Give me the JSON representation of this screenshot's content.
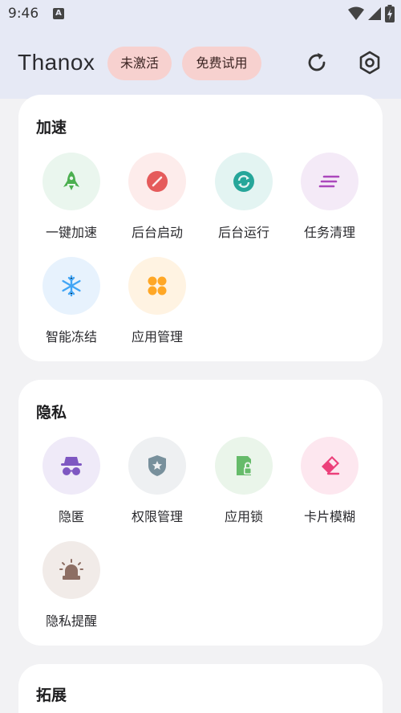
{
  "status_bar": {
    "time": "9:46",
    "notification_letter": "A"
  },
  "app_bar": {
    "title": "Thanox",
    "chip_inactive": "未激活",
    "chip_trial": "免费试用"
  },
  "sections": {
    "boost": {
      "title": "加速",
      "items": [
        {
          "label": "一键加速",
          "icon": "rocket-icon",
          "color": "#4caf50",
          "bg": "#eaf6ee"
        },
        {
          "label": "后台启动",
          "icon": "block-icon",
          "color": "#e55b5b",
          "bg": "#fdeceb"
        },
        {
          "label": "后台运行",
          "icon": "sync-icon",
          "color": "#26a69a",
          "bg": "#e3f4f2"
        },
        {
          "label": "任务清理",
          "icon": "clean-icon",
          "color": "#ab47bc",
          "bg": "#f4eaf7"
        },
        {
          "label": "智能冻结",
          "icon": "snowflake-icon",
          "color": "#42a5f5",
          "bg": "#e7f2fd"
        },
        {
          "label": "应用管理",
          "icon": "apps-icon",
          "color": "#ffa726",
          "bg": "#fff3e2"
        }
      ]
    },
    "privacy": {
      "title": "隐私",
      "items": [
        {
          "label": "隐匿",
          "icon": "incognito-icon",
          "color": "#7e57c2",
          "bg": "#efeaf8"
        },
        {
          "label": "权限管理",
          "icon": "shield-star-icon",
          "color": "#78909c",
          "bg": "#eef0f2"
        },
        {
          "label": "应用锁",
          "icon": "app-lock-icon",
          "color": "#66bb6a",
          "bg": "#eaf5ea"
        },
        {
          "label": "卡片模糊",
          "icon": "eraser-icon",
          "color": "#ec407a",
          "bg": "#fde7ef"
        },
        {
          "label": "隐私提醒",
          "icon": "alarm-light-icon",
          "color": "#8d6e63",
          "bg": "#f1ebe8"
        }
      ]
    },
    "extension": {
      "title": "拓展"
    }
  }
}
